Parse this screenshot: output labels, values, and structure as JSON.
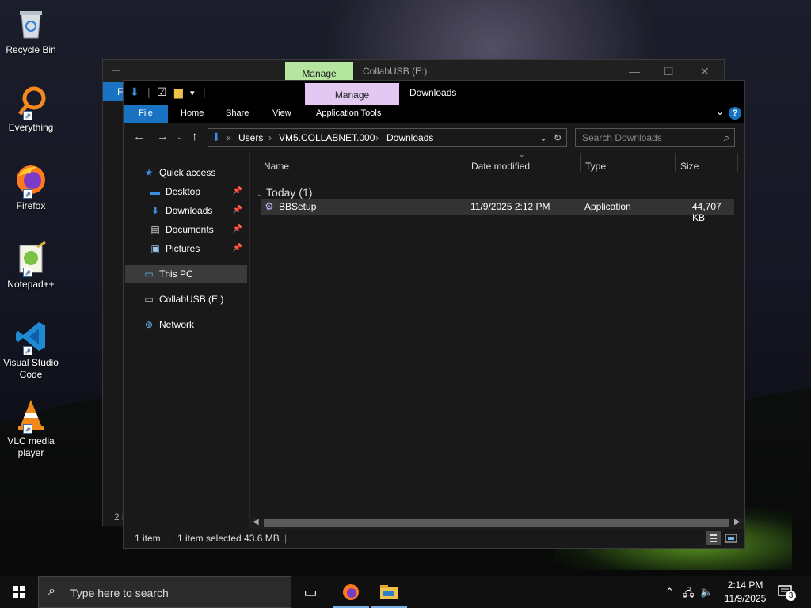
{
  "desktop": {
    "icons": [
      {
        "label": "Recycle Bin",
        "icon": "recycle-bin-icon"
      },
      {
        "label": "Everything",
        "icon": "everything-search-icon"
      },
      {
        "label": "Firefox",
        "icon": "firefox-icon"
      },
      {
        "label": "Notepad++",
        "icon": "notepad-plus-plus-icon"
      },
      {
        "label": "Visual Studio Code",
        "icon": "vscode-icon"
      },
      {
        "label": "VLC media player",
        "icon": "vlc-icon"
      }
    ]
  },
  "back_window": {
    "manage_tab": "Manage",
    "title": "CollabUSB (E:)",
    "file_tab": "F",
    "status": "2 i"
  },
  "window": {
    "manage_tab": "Manage",
    "title": "Downloads",
    "menu": {
      "file": "File",
      "home": "Home",
      "share": "Share",
      "view": "View",
      "app_tools": "Application Tools",
      "help": "?"
    },
    "address": {
      "overflow": "«",
      "crumbs": [
        "Users",
        "VM5.COLLABNET.000",
        "Downloads"
      ],
      "separator": "›"
    },
    "search_placeholder": "Search Downloads",
    "nav": {
      "quick_access": "Quick access",
      "desktop": "Desktop",
      "downloads": "Downloads",
      "documents": "Documents",
      "pictures": "Pictures",
      "this_pc": "This PC",
      "collabusb": "CollabUSB (E:)",
      "network": "Network"
    },
    "columns": {
      "name": "Name",
      "date_modified": "Date modified",
      "type": "Type",
      "size": "Size"
    },
    "group": "Today (1)",
    "files": [
      {
        "name": "BBSetup",
        "date": "11/9/2025 2:12 PM",
        "type": "Application",
        "size": "44,707 KB"
      }
    ],
    "status": {
      "items": "1 item",
      "selected": "1 item selected  43.6 MB"
    }
  },
  "taskbar": {
    "search_placeholder": "Type here to search",
    "time": "2:14 PM",
    "date": "11/9/2025",
    "notification_count": "3"
  },
  "colors": {
    "accent": "#1a73c2",
    "manage_purple": "#e3c8f2",
    "manage_green": "#b5e6a0"
  }
}
